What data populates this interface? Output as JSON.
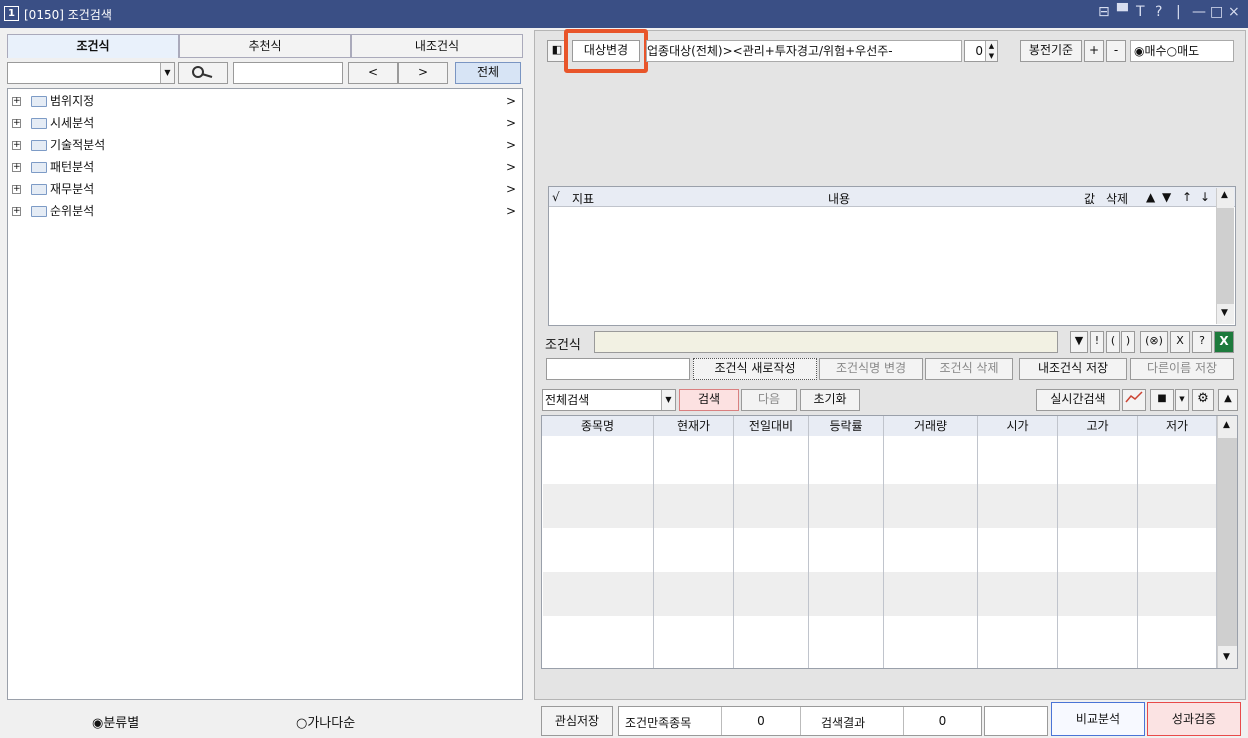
{
  "window": {
    "number": "1",
    "title": "[0150] 조건검색",
    "controls": [
      "⊟",
      "▀",
      "T",
      "?",
      "|",
      "—",
      "□",
      "×"
    ]
  },
  "left": {
    "tabs": [
      "조건식",
      "추천식",
      "내조건식"
    ],
    "search": {
      "prev": "<",
      "next": ">",
      "all": "전체"
    },
    "tree": [
      {
        "label": "범위지정",
        "arrow": ">"
      },
      {
        "label": "시세분석",
        "arrow": ">"
      },
      {
        "label": "기술적분석",
        "arrow": ">"
      },
      {
        "label": "패턴분석",
        "arrow": ">"
      },
      {
        "label": "재무분석",
        "arrow": ">"
      },
      {
        "label": "순위분석",
        "arrow": ">"
      }
    ],
    "sort": {
      "by_category": "분류별",
      "by_alpha": "가나다순",
      "selected": "by_category"
    }
  },
  "right": {
    "target_change": "대상변경",
    "target_text": "업종대상(전체)><관리+투자경고/위험+우선주-",
    "count": "0",
    "basis": "봉전기준",
    "plus": "+",
    "minus": "-",
    "buy": "매수",
    "sell": "매도",
    "selected_side": "buy",
    "ind_table": {
      "check": "√",
      "indicator": "지표",
      "content": "내용",
      "value": "값",
      "delete": "삭제",
      "up": "▲",
      "down": "▼",
      "top": "↑",
      "bottom": "↓"
    },
    "cond_label": "조건식",
    "cond_tools": [
      "▼",
      "!",
      "(",
      ")",
      "(⊗)",
      "X",
      "?"
    ],
    "buttons": {
      "new": "조건식 새로작성",
      "rename": "조건식명 변경",
      "delete": "조건식 삭제",
      "save_mine": "내조건식 저장",
      "save_as": "다른이름 저장"
    },
    "search_mode": "전체검색",
    "search": "검색",
    "next": "다음",
    "reset": "초기화",
    "realtime": "실시간검색",
    "result_columns": [
      "종목명",
      "현재가",
      "전일대비",
      "등락률",
      "거래량",
      "시가",
      "고가",
      "저가"
    ],
    "footer": {
      "save_interest": "관심저장",
      "satisfied_label": "조건만족종목",
      "satisfied": "0",
      "result_label": "검색결과",
      "result": "0",
      "compare": "비교분석",
      "verify": "성과검증"
    }
  },
  "colors": {
    "titlebar": "#3a4f85",
    "highlight": "#e8552a",
    "verify": "#e84a4a",
    "compare": "#4a74d6"
  }
}
